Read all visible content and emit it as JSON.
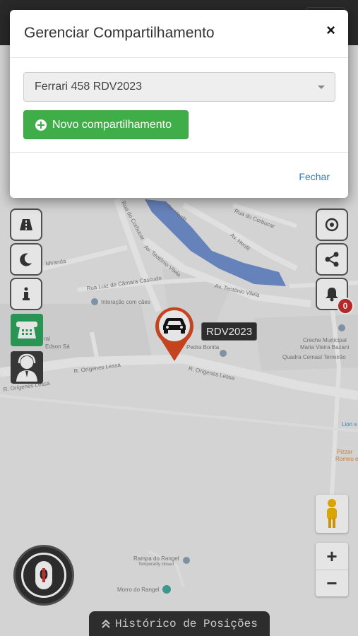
{
  "modal": {
    "title": "Gerenciar Compartilhamento",
    "close_icon": "×",
    "vehicle_select": {
      "selected": "Ferrari 458 RDV2023"
    },
    "new_share_button": "Novo compartilhamento",
    "close_button": "Fechar"
  },
  "map": {
    "labels": {
      "rua_do_corbucar": "Rua do Corbucar",
      "av_henfil": "Av. Henfil",
      "av_henfil_2": "Av. Henfil",
      "av_teotonio_vilela": "Av. Teotônio Vilela",
      "av_teotonio_vilela_2": "Av. Teotônio Vilela",
      "rua_luiz_camara": "Rua Luiz de Câmara Cascudo",
      "interacao_caes": "Interação com cães",
      "miranda": "Miranda",
      "rua_edson": "Edson Sá",
      "ral": "ral",
      "pedra_bonita": "Pedra Bonita",
      "r_origenes_lessa": "R. Orígenes Lessa",
      "r_origenes_lessa_2": "R. Orígenes Lessa",
      "r_origenes_lessa_3": "R. Orígenes Lessa",
      "creche": "Creche Municipal",
      "creche_2": "Maria Vieira Bazani",
      "quadra": "Quadra Cemasi Terreirão",
      "lion": "Lion s",
      "pizzaria": "Pizzar",
      "pizzaria_2": "Romeu e",
      "rampa": "Rampa do Rangel",
      "rampa_sub": "Temporarily closed",
      "morro": "Morro do Rangel"
    },
    "vehicle_plate": "RDV2023"
  },
  "controls": {
    "notification_count": "0",
    "speed": "0",
    "zoom_in": "+",
    "zoom_out": "−"
  },
  "history_bar": {
    "label": "Histórico de Posições"
  },
  "icons": {
    "road": "road-icon",
    "moon": "moon-icon",
    "info": "info-icon",
    "phone": "phone-icon",
    "agent": "support-agent-icon",
    "locate": "locate-icon",
    "share": "share-icon",
    "bell": "bell-icon",
    "car": "car-icon",
    "pegman": "street-view-icon"
  },
  "colors": {
    "accent_green": "#3fae49",
    "link_blue": "#2a7bbf",
    "marker_red": "#d9481e",
    "badge_red": "#c62828"
  }
}
